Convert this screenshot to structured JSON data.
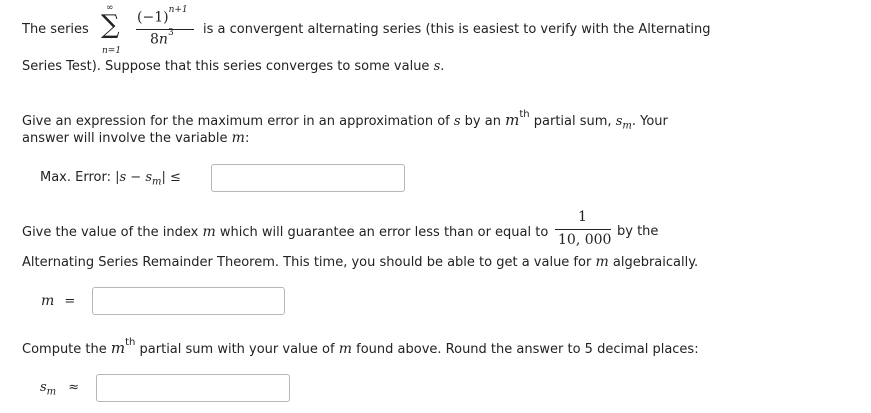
{
  "intro": {
    "the_series": "The series",
    "sum_upper": "∞",
    "sum_lower": "n=1",
    "numerator": "(−1)",
    "numerator_exp": "n+1",
    "denominator": "8n",
    "denominator_exp": "3",
    "after_series": "is a convergent alternating series (this is easiest to verify with the Alternating",
    "line2_start": "Series Test). Suppose that this series converges to some value",
    "line2_var": "s",
    "line2_end": "."
  },
  "q1": {
    "line1_a": "Give an expression for the maximum error in an approximation of",
    "line1_s": "s",
    "line1_b": "by an",
    "line1_m": "m",
    "line1_th": "th",
    "line1_c": "partial sum,",
    "line1_sm": "s",
    "line1_sm_sub": "m",
    "line1_d": ". Your",
    "line2_a": "answer will involve the variable",
    "line2_m": "m",
    "line2_b": ":",
    "label_text": "Max. Error:",
    "label_math": "|s − s",
    "label_math_sub": "m",
    "label_math_end": "|  ≤",
    "input_value": ""
  },
  "q2": {
    "line1_a": "Give the value of the index",
    "line1_m": "m",
    "line1_b": "which will guarantee an error less than or equal to",
    "frac_num": "1",
    "frac_den": "10, 000",
    "line1_c": "by the",
    "line2_a": "Alternating Series Remainder Theorem. This time, you should be able to get a value for",
    "line2_m": "m",
    "line2_b": "algebraically.",
    "label_var": "m",
    "label_rel": "=",
    "input_value": ""
  },
  "q3": {
    "line1_a": "Compute the",
    "line1_m": "m",
    "line1_th": "th",
    "line1_b": "partial sum with your value of",
    "line1_m2": "m",
    "line1_c": "found above. Round the answer to 5 decimal places:",
    "label_var": "s",
    "label_sub": "m",
    "label_rel": "≈",
    "input_value": ""
  }
}
